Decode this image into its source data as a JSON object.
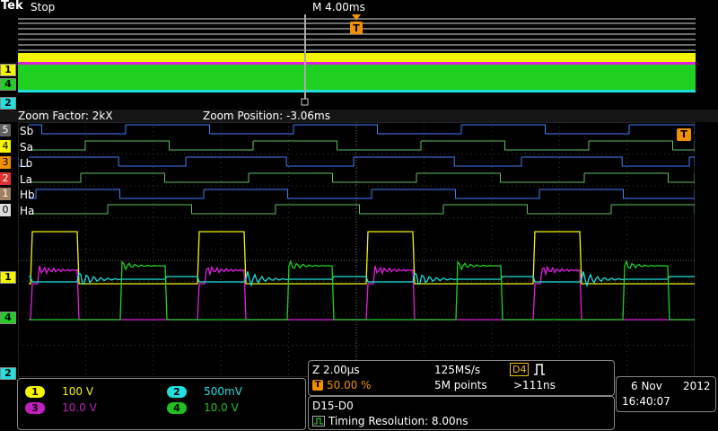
{
  "header": {
    "brand": "Tek",
    "acq_state": "Stop",
    "timebase": "M 4.00ms",
    "trigger_marker": "T"
  },
  "zoom_bar": {
    "factor": "Zoom Factor: 2kX",
    "position": "Zoom Position: -3.06ms"
  },
  "channel_markers": {
    "overview": [
      "1",
      "4",
      "2"
    ],
    "zoom_analog": [
      "1",
      "4",
      "2"
    ],
    "digital": [
      "5",
      "4",
      "3",
      "2",
      "1",
      "0"
    ]
  },
  "digital_labels": [
    "Sb",
    "Sa",
    "Lb",
    "La",
    "Hb",
    "Ha"
  ],
  "channels": {
    "ch1": {
      "num": "1",
      "scale": "100 V",
      "color": "#f5f500"
    },
    "ch2": {
      "num": "2",
      "scale": "500mV",
      "color": "#20e0e0"
    },
    "ch3": {
      "num": "3",
      "scale": "10.0 V",
      "color": "#e020e0"
    },
    "ch4": {
      "num": "4",
      "scale": "10.0 V",
      "color": "#20d020"
    }
  },
  "horizontal": {
    "zoom_scale": "Z 2.00µs",
    "sample_rate": "125MS/s",
    "trigger_pos": "50.00 %",
    "record_length": "5M points",
    "trigger_source": "D4",
    "trigger_level": ">111ns"
  },
  "bus": {
    "label": "D15-D0",
    "timing_resolution": "Timing Resolution: 8.00ns"
  },
  "datetime": {
    "date_day": "6 Nov",
    "date_year": "2012",
    "time": "16:40:07"
  },
  "colors": {
    "grid": "#3a3a3a",
    "yellow": "#f5f500",
    "cyan": "#20e0e0",
    "magenta": "#e020e0",
    "green": "#20d020",
    "digital_green": "#60c060",
    "digital_blue": "#4080ff",
    "orange": "#f09000"
  }
}
